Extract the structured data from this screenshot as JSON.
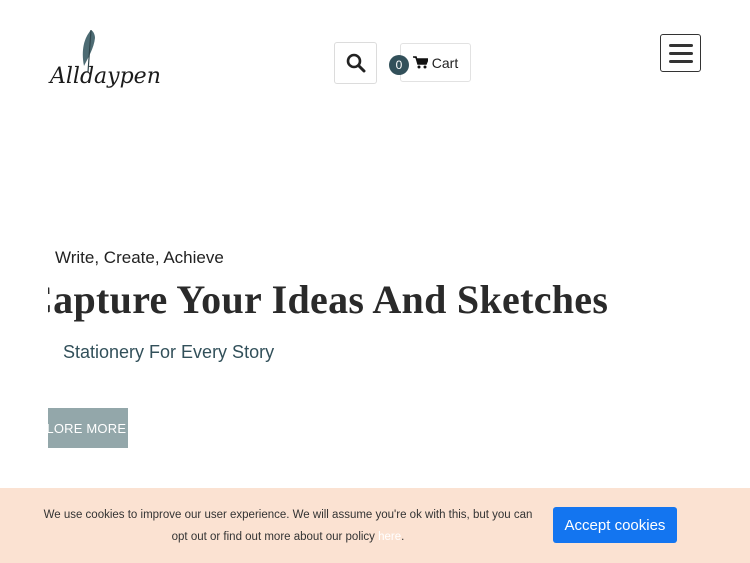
{
  "header": {
    "logo_text": "Alldaypens",
    "cart_count": "0",
    "cart_label": "Cart"
  },
  "hero": {
    "eyebrow": "Write, Create, Achieve",
    "headline": "Capture Your Ideas And Sketches",
    "subline": "Stationery For Every Story",
    "button_label": "EXPLORE MORE"
  },
  "cookie_bar": {
    "text": "We use cookies to improve our user experience. We will assume you're ok with this, but you can opt out or find out more about our policy ",
    "link_text": "here",
    "suffix": ".",
    "accept_label": "Accept cookies"
  },
  "colors": {
    "accent": "#32505a",
    "button_muted": "#93a7aa",
    "cookie_bg": "#fbe2d2",
    "accept_button": "#1375f0"
  },
  "icons": [
    "feather-icon",
    "search-icon",
    "cart-icon",
    "hamburger-menu-icon"
  ]
}
